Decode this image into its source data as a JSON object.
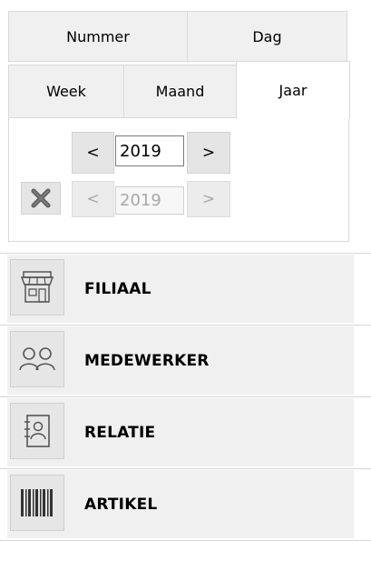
{
  "tabs": {
    "row1": [
      {
        "label": "Nummer"
      },
      {
        "label": "Dag"
      }
    ],
    "row2": [
      {
        "label": "Week"
      },
      {
        "label": "Maand"
      },
      {
        "label": "Jaar",
        "active": true
      }
    ]
  },
  "year_picker": {
    "from": {
      "prev": "<",
      "value": "2019",
      "next": ">"
    },
    "to": {
      "prev": "<",
      "value": "2019",
      "next": ">",
      "disabled": true
    }
  },
  "nav": [
    {
      "label": "FILIAAL",
      "icon": "store-icon"
    },
    {
      "label": "MEDEWERKER",
      "icon": "people-icon"
    },
    {
      "label": "RELATIE",
      "icon": "contact-book-icon"
    },
    {
      "label": "ARTIKEL",
      "icon": "barcode-icon"
    }
  ],
  "colors": {
    "tab_bg": "#f0f0f0",
    "row_bg": "#f0f0f0",
    "border": "#d9d9d9"
  }
}
